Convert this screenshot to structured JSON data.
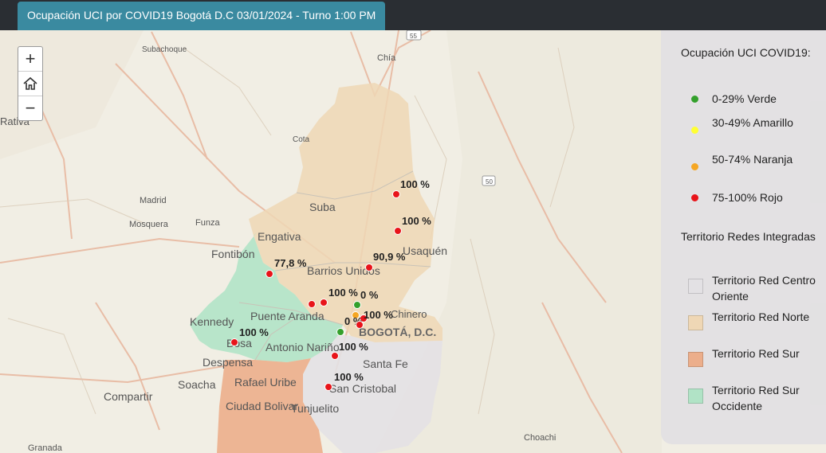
{
  "header": {
    "title": "Ocupación UCI por COVID19 Bogotá D.C 03/01/2024 - Turno 1:00 PM"
  },
  "zoom_controls": {
    "zoom_in": "+",
    "home_icon": "home-icon",
    "zoom_out": "−"
  },
  "legend": {
    "title_occupancy": "Ocupación UCI COVID19:",
    "occupancy": [
      {
        "label": "0-29% Verde",
        "color": "#34a02c"
      },
      {
        "label": "30-49% Amarillo",
        "color": "#ffff33"
      },
      {
        "label": "50-74% Naranja",
        "color": "#f5a623"
      },
      {
        "label": "75-100% Rojo",
        "color": "#e8141a"
      }
    ],
    "title_territory": "Territorio Redes Integradas",
    "territories": [
      {
        "label": "Territorio Red Centro Oriente",
        "color": "#e3e1e4"
      },
      {
        "label": "Territorio Red Norte",
        "color": "#efd7b5"
      },
      {
        "label": "Territorio Red Sur",
        "color": "#ecae8b"
      },
      {
        "label": "Territorio Red Sur Occidente",
        "color": "#b1e3c6"
      }
    ]
  },
  "map": {
    "place_labels": [
      "Suba",
      "Engativa",
      "Fontibón",
      "Barrios Unidos",
      "Puente Aranda",
      "Kennedy",
      "Bosa",
      "Antonio Nariño",
      "Despensa",
      "Soacha",
      "Compartir",
      "Rafael Uribe",
      "Ciudad Bolivar",
      "Tunjuelito",
      "Santa Fe",
      "San Cristobal",
      "Usaquén",
      "BOGOTÁ, D.C.",
      "Madrid",
      "Mosquera",
      "Funza",
      "Chía",
      "Chinero",
      "Choachi",
      "Granada",
      "Cota",
      "Subachoque",
      "Rativa",
      "55",
      "50"
    ],
    "hospitals": [
      {
        "label": "100 %",
        "color": "#e8141a"
      },
      {
        "label": "100 %",
        "color": "#e8141a"
      },
      {
        "label": "90,9 %",
        "color": "#e8141a"
      },
      {
        "label": "77,8 %",
        "color": "#e8141a"
      },
      {
        "label": "100 %",
        "color": "#e8141a"
      },
      {
        "label": "",
        "color": "#e8141a"
      },
      {
        "label": "0 %",
        "color": "#34a02c"
      },
      {
        "label": "100 %",
        "color": "#e8141a"
      },
      {
        "label": "0 %",
        "color": "#f5a623"
      },
      {
        "label": "",
        "color": "#e8141a"
      },
      {
        "label": "",
        "color": "#34a02c"
      },
      {
        "label": "100 %",
        "color": "#e8141a"
      },
      {
        "label": "100 %",
        "color": "#e8141a"
      },
      {
        "label": "100 %",
        "color": "#e8141a"
      }
    ]
  }
}
